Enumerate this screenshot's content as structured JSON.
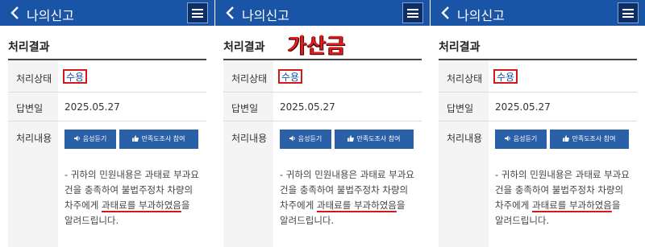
{
  "panels": [
    {
      "header": {
        "back_icon": "chevron-left-icon",
        "title": "나의신고",
        "menu_icon": "hamburger-menu-icon"
      },
      "section_title": "처리결과",
      "rows": {
        "status_label": "처리상태",
        "status_value": "수용",
        "date_label": "답변일",
        "date_value": "2025.05.27",
        "content_label": "처리내용"
      },
      "buttons": {
        "voice_label": "음성듣기",
        "voice_icon": "speaker-icon",
        "survey_label": "만족도조사 참여",
        "survey_icon": "thumbs-up-icon"
      },
      "content": {
        "line1": "- 귀하의 민원내용은 과태료 부과요",
        "line2": "건을 충족하여 불법주정차 차량의",
        "line3_pre": "차주에게 ",
        "line3_highlight": "과태료를 부과하였음",
        "line3_post": "을",
        "line4": "알려드립니다."
      }
    },
    {
      "header": {
        "back_icon": "chevron-left-icon",
        "title": "나의신고",
        "menu_icon": "hamburger-menu-icon"
      },
      "section_title": "처리결과",
      "stamp_text": "가산금",
      "rows": {
        "status_label": "처리상태",
        "status_value": "수용",
        "date_label": "답변일",
        "date_value": "2025.05.27",
        "content_label": "처리내용"
      },
      "buttons": {
        "voice_label": "음성듣기",
        "voice_icon": "speaker-icon",
        "survey_label": "만족도조사 참여",
        "survey_icon": "thumbs-up-icon"
      },
      "content": {
        "line1": "- 귀하의 민원내용은 과태료 부과요",
        "line2": "건을 충족하여 불법주정차 차량의",
        "line3_pre": "차주에게 ",
        "line3_highlight": "과태료를 부과하였음",
        "line3_post": "을",
        "line4": "알려드립니다."
      }
    },
    {
      "header": {
        "back_icon": "chevron-left-icon",
        "title": "나의신고",
        "menu_icon": "hamburger-menu-icon"
      },
      "section_title": "처리결과",
      "rows": {
        "status_label": "처리상태",
        "status_value": "수용",
        "date_label": "답변일",
        "date_value": "2025.05.27",
        "content_label": "처리내용"
      },
      "buttons": {
        "voice_label": "음성듣기",
        "voice_icon": "speaker-icon",
        "survey_label": "만족도조사 참여",
        "survey_icon": "thumbs-up-icon"
      },
      "content": {
        "line1": "- 귀하의 민원내용은 과태료 부과요",
        "line2": "건을 충족하여 불법주정차 차량의",
        "line3_pre": "차주에게 ",
        "line3_highlight": "과태료를 부과하였음",
        "line3_post": "을",
        "line4": "알려드립니다."
      }
    }
  ],
  "colors": {
    "header_bg": "#1a54a6",
    "button_bg": "#2a60a8",
    "highlight_red": "#d01a1a",
    "status_text": "#1a54a6"
  }
}
